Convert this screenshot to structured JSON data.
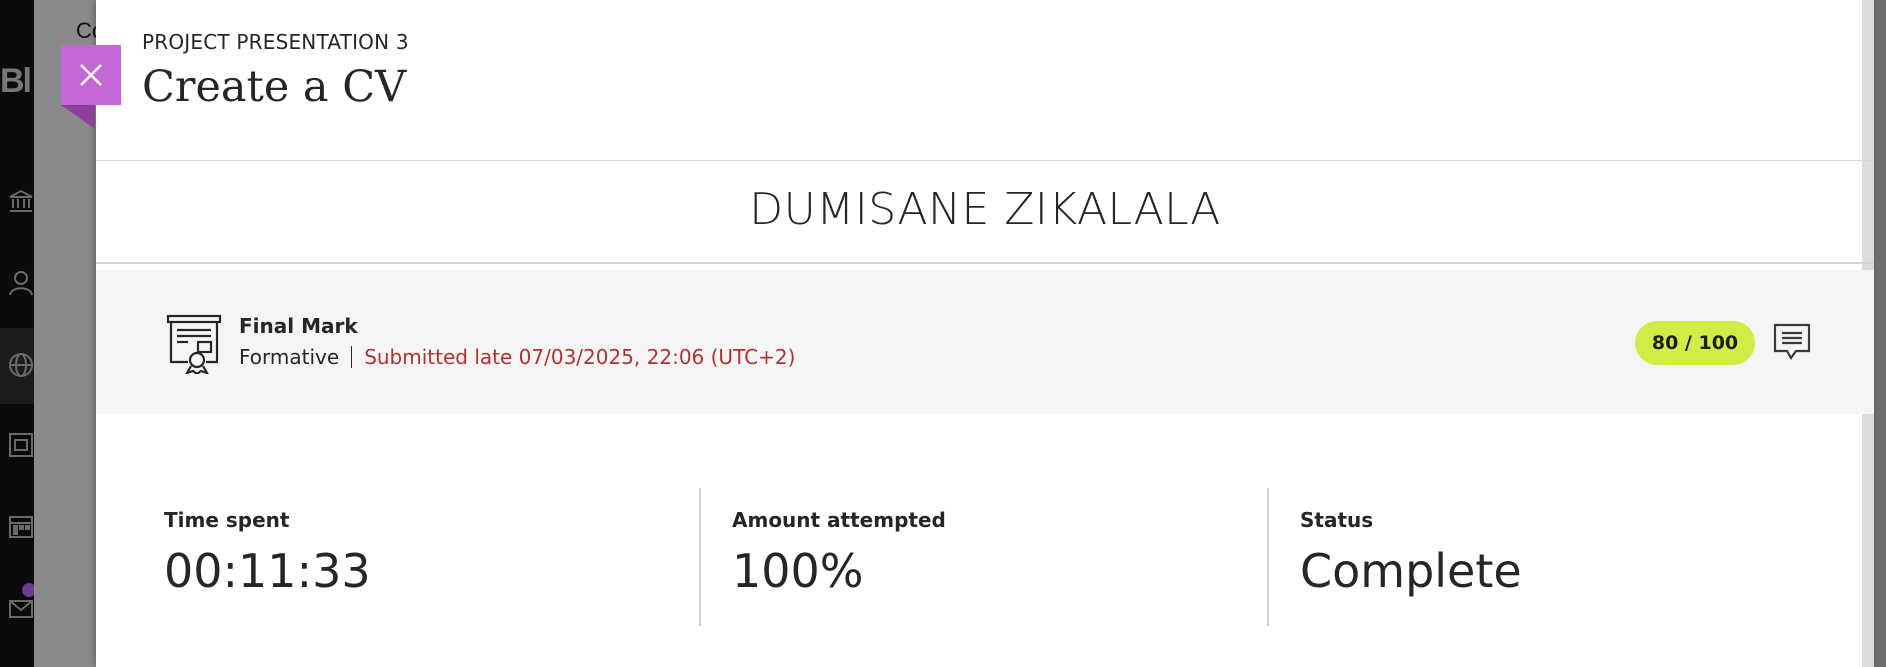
{
  "background": {
    "logo_text": "Bl",
    "breadcrumb_fragment": "Co"
  },
  "header": {
    "eyebrow": "PROJECT PRESENTATION 3",
    "title": "Create a CV"
  },
  "close_button": {
    "icon": "close-icon",
    "color": "#c466d6"
  },
  "student": {
    "name": "DUMISANE ZIKALALA"
  },
  "grade": {
    "title": "Final Mark",
    "type": "Formative",
    "submission_status": "Submitted late 07/03/2025, 22:06 (UTC+2)",
    "score": "80 / 100",
    "score_color": "#d2ec45",
    "late_color": "#b4322e",
    "feedback_icon": "comment-icon",
    "doc_icon": "certificate-document-icon"
  },
  "stats": [
    {
      "label": "Time spent",
      "value": "00:11:33"
    },
    {
      "label": "Amount attempted",
      "value": "100%"
    },
    {
      "label": "Status",
      "value": "Complete"
    }
  ]
}
